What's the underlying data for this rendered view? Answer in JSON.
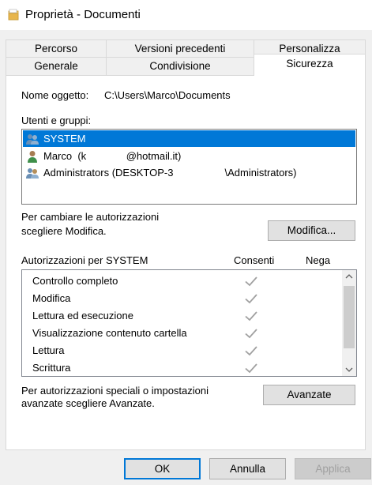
{
  "window": {
    "title": "Proprietà - Documenti"
  },
  "tabs": {
    "row_back": [
      "Percorso",
      "Versioni precedenti",
      "Personalizza"
    ],
    "row_front": [
      "Generale",
      "Condivisione",
      "Sicurezza"
    ],
    "active": "Sicurezza"
  },
  "security": {
    "object_label": "Nome oggetto:",
    "object_value": "C:\\Users\\Marco\\Documents",
    "groups_label": "Utenti e gruppi:",
    "users": [
      {
        "name": "SYSTEM",
        "selected": true,
        "icon": "group-users-icon"
      },
      {
        "name": "Marco  (k              @hotmail.it)",
        "selected": false,
        "icon": "user-icon"
      },
      {
        "name": "Administrators (DESKTOP-3                  \\Administrators)",
        "selected": false,
        "icon": "group-users-icon"
      }
    ],
    "change_hint_line1": "Per cambiare le autorizzazioni",
    "change_hint_line2": "scegliere Modifica.",
    "edit_button": "Modifica...",
    "perms_header": "Autorizzazioni per SYSTEM",
    "allow_header": "Consenti",
    "deny_header": "Nega",
    "permissions": [
      {
        "name": "Controllo completo",
        "allow": true,
        "deny": false
      },
      {
        "name": "Modifica",
        "allow": true,
        "deny": false
      },
      {
        "name": "Lettura ed esecuzione",
        "allow": true,
        "deny": false
      },
      {
        "name": "Visualizzazione contenuto cartella",
        "allow": true,
        "deny": false
      },
      {
        "name": "Lettura",
        "allow": true,
        "deny": false
      },
      {
        "name": "Scrittura",
        "allow": true,
        "deny": false
      }
    ],
    "advanced_hint_line1": "Per autorizzazioni speciali o impostazioni",
    "advanced_hint_line2": "avanzate scegliere Avanzate.",
    "advanced_button": "Avanzate"
  },
  "footer": {
    "ok": "OK",
    "cancel": "Annulla",
    "apply": "Applica"
  },
  "colors": {
    "selection": "#0078d7",
    "check": "#a0a0a0",
    "folder": "#e8b64c"
  }
}
